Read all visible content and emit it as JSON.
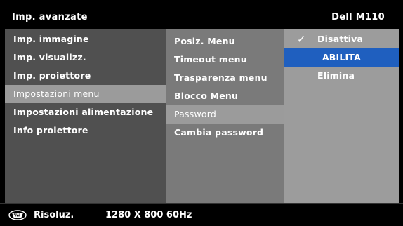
{
  "header": {
    "title": "Imp. avanzate",
    "model": "Dell M110"
  },
  "menu_main": [
    "Imp. immagine",
    "Imp. visualizz.",
    "Imp. proiettore",
    "Impostazioni menu",
    "Impostazioni alimentazione",
    "Info proiettore"
  ],
  "menu_main_selected": "Impostazioni menu",
  "menu_sub": [
    "Posiz. Menu",
    "Timeout menu",
    "Trasparenza menu",
    "Blocco Menu",
    "Password",
    "Cambia password"
  ],
  "menu_sub_selected": "Password",
  "options": [
    "Disattiva",
    "ABILITA",
    "Elimina"
  ],
  "options_checked": "Disattiva",
  "options_focused": "ABILITA",
  "status": {
    "icon": "vga-connector-icon",
    "label": "Risoluz.",
    "value": "1280 X 800 60Hz"
  },
  "colors": {
    "focus": "#1f5fbf",
    "selected_row": "#9b9b9b"
  }
}
